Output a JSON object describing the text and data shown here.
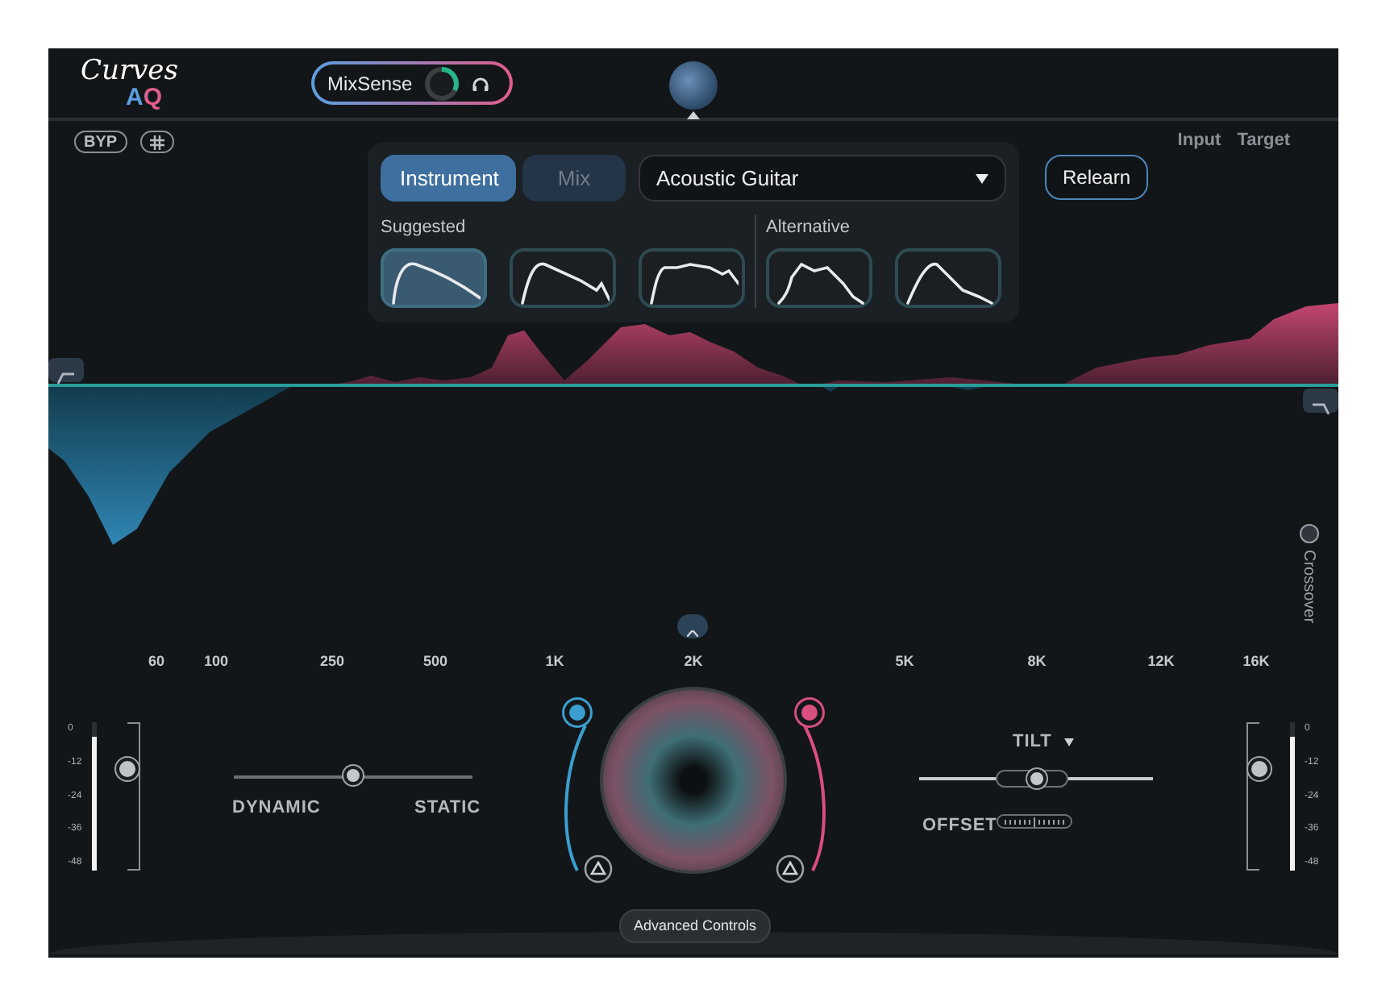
{
  "header": {
    "logo": {
      "line_1": "Curves",
      "line_2": "AQ"
    },
    "mixsense": {
      "label": "MixSense",
      "on": true
    }
  },
  "toolbar": {
    "bypass": "BYP",
    "legend": [
      "Input",
      "Target"
    ]
  },
  "panel": {
    "modes": [
      {
        "label": "Instrument",
        "selected": true
      },
      {
        "label": "Mix",
        "selected": false
      }
    ],
    "preset": "Acoustic Guitar",
    "relearn": "Relearn",
    "groups": [
      {
        "label": "Suggested",
        "curves": [
          {
            "selected": true
          },
          {
            "selected": false
          },
          {
            "selected": false
          }
        ]
      },
      {
        "label": "Alternative",
        "curves": [
          {
            "selected": false
          },
          {
            "selected": false
          }
        ]
      }
    ]
  },
  "spectrum": {
    "crossover": "Crossover"
  },
  "frequency_labels": [
    "60",
    "100",
    "250",
    "500",
    "1K",
    "2K",
    "5K",
    "8K",
    "12K",
    "16K"
  ],
  "input_meter": {
    "scale": [
      "0",
      "-12",
      "-24",
      "-36",
      "-48"
    ],
    "level": 0.9,
    "fader": {
      "level": 0.67
    }
  },
  "character": {
    "left": "DYNAMIC",
    "right": "STATIC",
    "level": 0.5
  },
  "tilt": {
    "label": "TILT",
    "level": 0.5,
    "offset": "OFFSET"
  },
  "advanced": "Advanced Controls",
  "output_meter": {
    "scale": [
      "0",
      "-12",
      "-24",
      "-36",
      "-48"
    ],
    "level": 0.9,
    "fader": {
      "level": 0.67
    }
  }
}
